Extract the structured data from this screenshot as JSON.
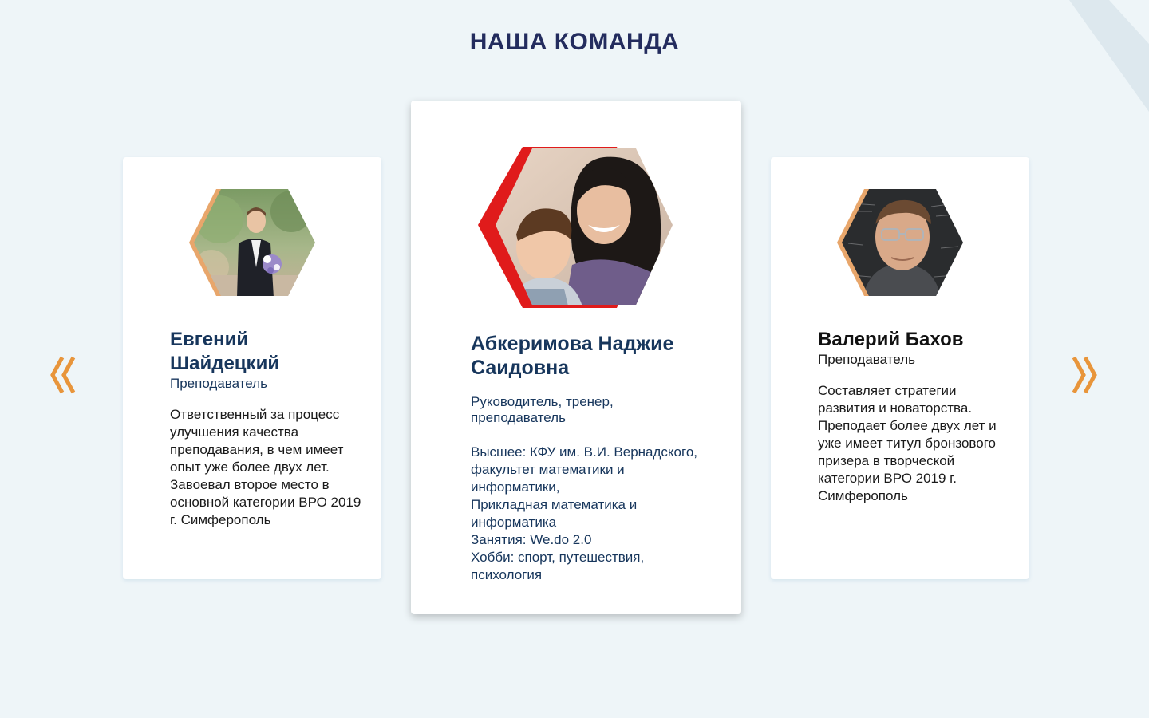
{
  "section": {
    "title": "НАША КОМАНДА"
  },
  "colors": {
    "background": "#eef5f8",
    "title": "#232c5e",
    "name": "#17365c",
    "accent_orange": "#e8953b",
    "accent_red": "#e01b1b"
  },
  "nav": {
    "prev_icon": "double-chevron-left-icon",
    "next_icon": "double-chevron-right-icon"
  },
  "team": [
    {
      "name_lines": [
        "Евгений",
        "Шайдецкий"
      ],
      "role": "Преподаватель",
      "bio": "Ответственный за процесс улучшения качества преподавания, в чем имеет опыт уже более двух лет. Завоевал второе место в основной категории ВРО 2019 г. Симферополь",
      "photo": "man-in-suit-with-bouquet-photo"
    },
    {
      "name_lines": [
        "Абкеримова Наджие",
        "Саидовна"
      ],
      "role_lines": [
        "Руководитель, тренер,",
        "преподаватель"
      ],
      "details": [
        "Высшее: КФУ им. В.И. Вернадского,",
        "факультет математики и",
        "информатики,",
        "Прикладная математика и",
        "информатика",
        "Занятия: We.do 2.0",
        "Хобби: спорт, путешествия,",
        "психология"
      ],
      "photo": "woman-and-boy-photo"
    },
    {
      "name_lines": [
        "Валерий Бахов"
      ],
      "role": "Преподаватель",
      "bio": "Составляет стратегии развития и новаторства. Преподает более двух лет и уже имеет титул бронзового призера в творческой категории ВРО 2019 г. Симферополь",
      "photo": "man-with-glasses-photo"
    }
  ]
}
